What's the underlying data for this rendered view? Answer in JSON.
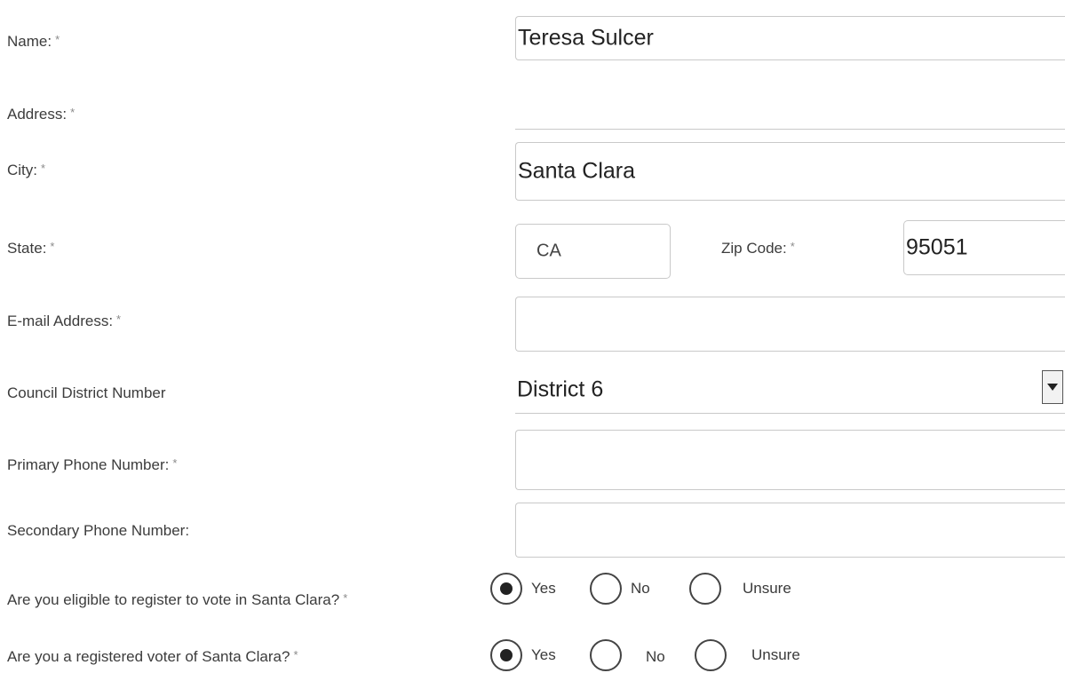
{
  "form": {
    "name": {
      "label": "Name:",
      "required": "*",
      "value": "Teresa Sulcer"
    },
    "address": {
      "label": "Address:",
      "required": "*",
      "value": ""
    },
    "city": {
      "label": "City:",
      "required": "*",
      "value": "Santa Clara"
    },
    "state": {
      "label": "State:",
      "required": "*",
      "value": "CA"
    },
    "zip": {
      "label": "Zip Code:",
      "required": "*",
      "value": "95051"
    },
    "email": {
      "label": "E-mail Address:",
      "required": "*",
      "value": ""
    },
    "district": {
      "label": "Council District Number",
      "value": "District 6"
    },
    "primary_phone": {
      "label": "Primary Phone Number:",
      "required": "*",
      "value": ""
    },
    "secondary_phone": {
      "label": "Secondary Phone Number:",
      "value": ""
    },
    "eligible": {
      "label": "Are you eligible to register to vote in Santa Clara?",
      "required": "*",
      "options": [
        "Yes",
        "No",
        "Unsure"
      ],
      "selected": "Yes"
    },
    "registered": {
      "label": "Are you a registered voter of Santa Clara?",
      "required": "*",
      "options": [
        "Yes",
        "No",
        "Unsure"
      ],
      "selected": "Yes"
    }
  }
}
